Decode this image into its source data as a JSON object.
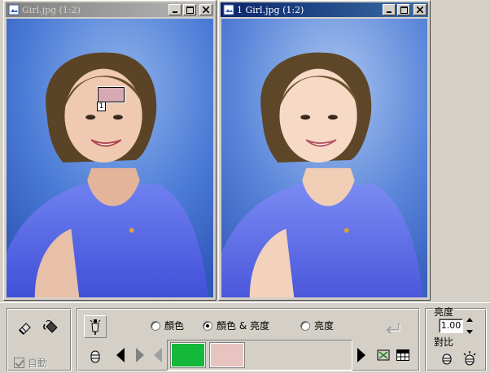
{
  "windows": {
    "left": {
      "title": "Girl.jpg (1:2)"
    },
    "right": {
      "title": "1 Girl.jpg (1:2)"
    }
  },
  "selection": {
    "number": "1",
    "color": "#d6a9b4"
  },
  "toolbar": {
    "auto_label": "自動",
    "auto_checked": true,
    "radio_color": "顏色",
    "radio_color_brightness": "顏色 & 亮度",
    "radio_brightness": "亮度",
    "selected_mode": "顏色 & 亮度",
    "swatch_target_color": "#14b83a",
    "swatch_source_color": "#e8c4c0",
    "brightness_label": "亮度",
    "brightness_value": "1.00",
    "contrast_label": "對比"
  },
  "icons": {
    "eraser": "eraser-icon",
    "paint": "paint-bucket-icon",
    "dropper": "dropper-icon",
    "mask": "mask-icon",
    "undo": "return-arrow-icon",
    "fit": "fit-icon",
    "grid": "grid-icon"
  },
  "colors": {
    "face_bg": "#d4d0c8",
    "title_active": "#0a246a",
    "title_inactive": "#808080",
    "sky_blue": "#3f6fd2",
    "shirt_blue": "#5566e0"
  }
}
